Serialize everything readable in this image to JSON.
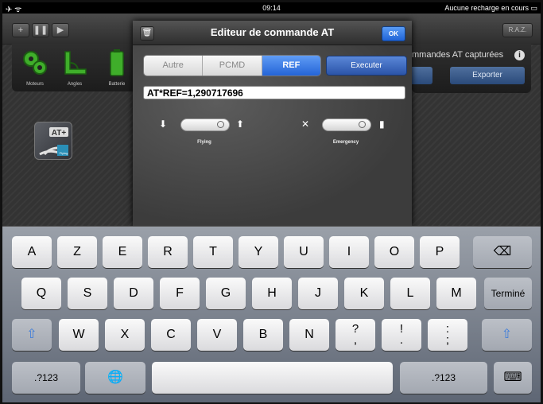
{
  "status": {
    "time": "09:14",
    "battery_text": "Aucune recharge en cours"
  },
  "toolbar": {
    "raz_label": "R.A.Z."
  },
  "sensors": [
    {
      "label": "Moteurs"
    },
    {
      "label": "Angles"
    },
    {
      "label": "Batterie"
    }
  ],
  "captured": {
    "title": "mmandes AT capturées",
    "export_label": "Exporter"
  },
  "app_icon": {
    "label": "AT+",
    "sub": "Flying"
  },
  "modal": {
    "title": "Editeur de commande AT",
    "ok_label": "OK",
    "segments": [
      "Autre",
      "PCMD",
      "REF"
    ],
    "active_segment": "REF",
    "execute_label": "Executer",
    "command_value": "AT*REF=1,290717696",
    "flying_label": "Flying",
    "emergency_label": "Emergency"
  },
  "keyboard": {
    "row1": [
      "A",
      "Z",
      "E",
      "R",
      "T",
      "Y",
      "U",
      "I",
      "O",
      "P"
    ],
    "row2": [
      "Q",
      "S",
      "D",
      "F",
      "G",
      "H",
      "J",
      "K",
      "L",
      "M"
    ],
    "done_label": "Terminé",
    "row3": [
      "W",
      "X",
      "C",
      "V",
      "B",
      "N"
    ],
    "row3_punct": [
      [
        "?",
        ","
      ],
      [
        "!",
        "."
      ],
      [
        ":",
        ";"
      ]
    ],
    "numbers_label": ".?123"
  },
  "colors": {
    "accent": "#2464d7",
    "ok": "#1f63d6"
  }
}
